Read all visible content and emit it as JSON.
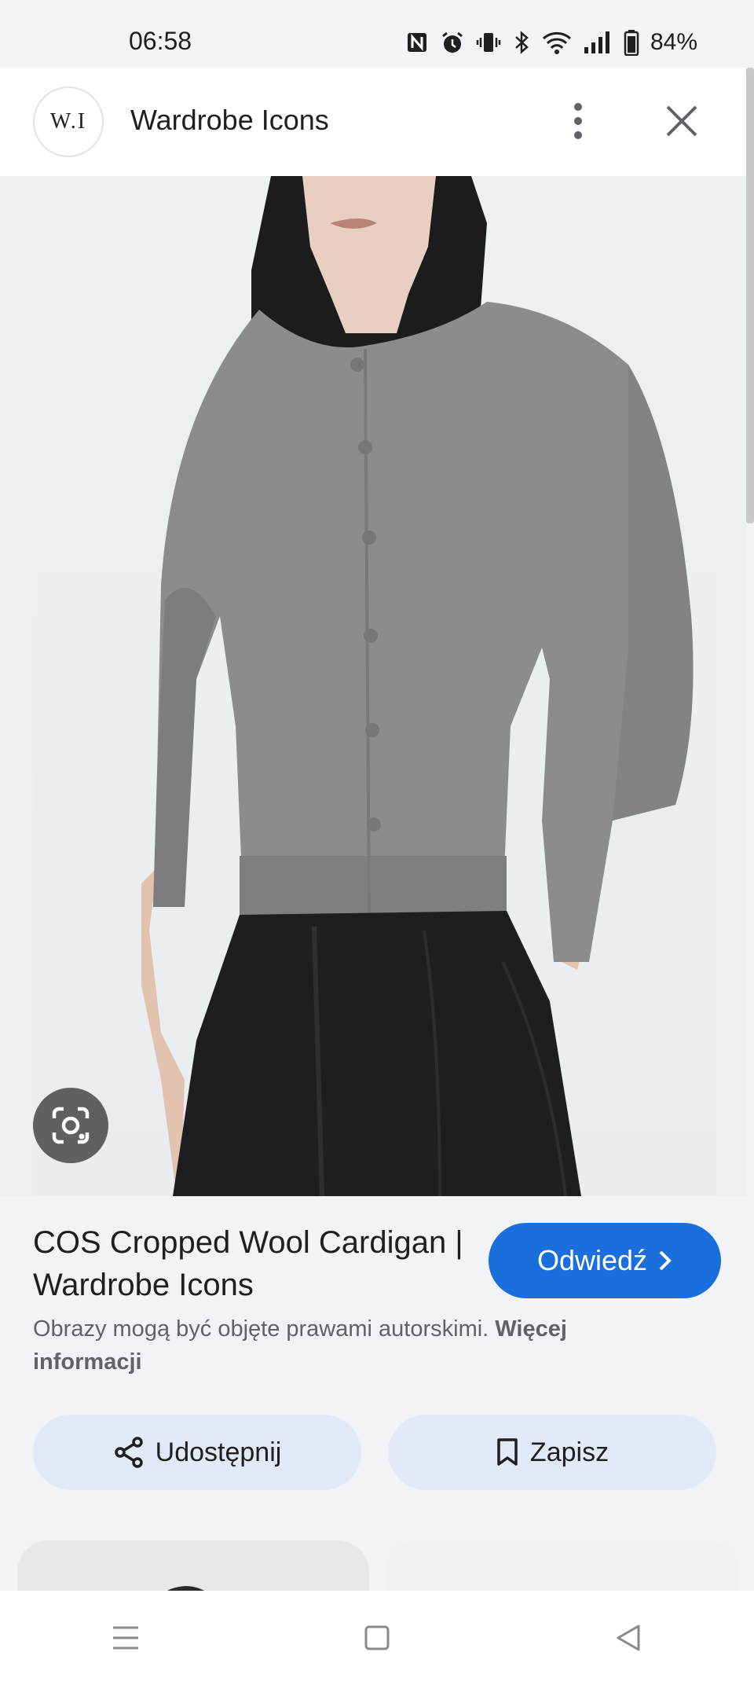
{
  "status_bar": {
    "time": "06:58",
    "battery": "84%",
    "icons": [
      "nfc-icon",
      "alarm-icon",
      "vibrate-icon",
      "bluetooth-icon",
      "wifi-icon",
      "signal-icon",
      "battery-icon"
    ]
  },
  "header": {
    "avatar_text": "W.I",
    "site_name": "Wardrobe Icons"
  },
  "image": {
    "lens_icon": "google-lens-icon"
  },
  "result": {
    "title": "COS Cropped Wool Cardigan | Wardrobe Icons",
    "visit_label": "Odwiedź",
    "copyright_text": "Obrazy mogą być objęte prawami autorskimi.",
    "more_info_link": "Więcej informacji",
    "share_label": "Udostępnij",
    "save_label": "Zapisz"
  },
  "colors": {
    "accent": "#1b6fdc",
    "button_bg": "#e2eaf8",
    "page_bg": "#f2f3f7"
  }
}
